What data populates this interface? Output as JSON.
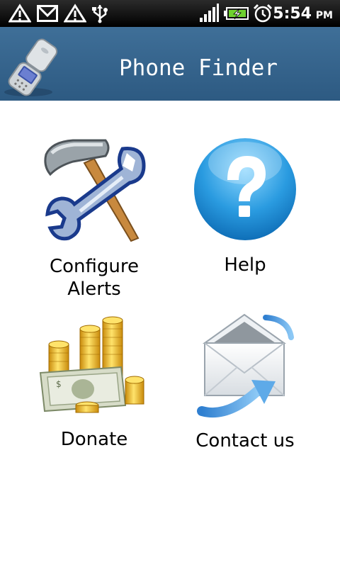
{
  "status_bar": {
    "time": "5:54",
    "ampm": "PM",
    "icons": [
      "alert-icon",
      "gmail-icon",
      "alert-icon",
      "usb-icon",
      "signal-icon",
      "battery-charging-icon",
      "alarm-clock-icon"
    ]
  },
  "header": {
    "title": "Phone Finder",
    "logo_icon": "flip-phone-icon"
  },
  "menu": {
    "items": [
      {
        "label": "Configure\nAlerts",
        "icon": "tools-icon"
      },
      {
        "label": "Help",
        "icon": "help-icon"
      },
      {
        "label": "Donate",
        "icon": "money-icon"
      },
      {
        "label": "Contact us",
        "icon": "envelope-icon"
      }
    ]
  },
  "colors": {
    "title_bar": "#346089",
    "status_bar": "#000000",
    "background": "#ffffff"
  }
}
